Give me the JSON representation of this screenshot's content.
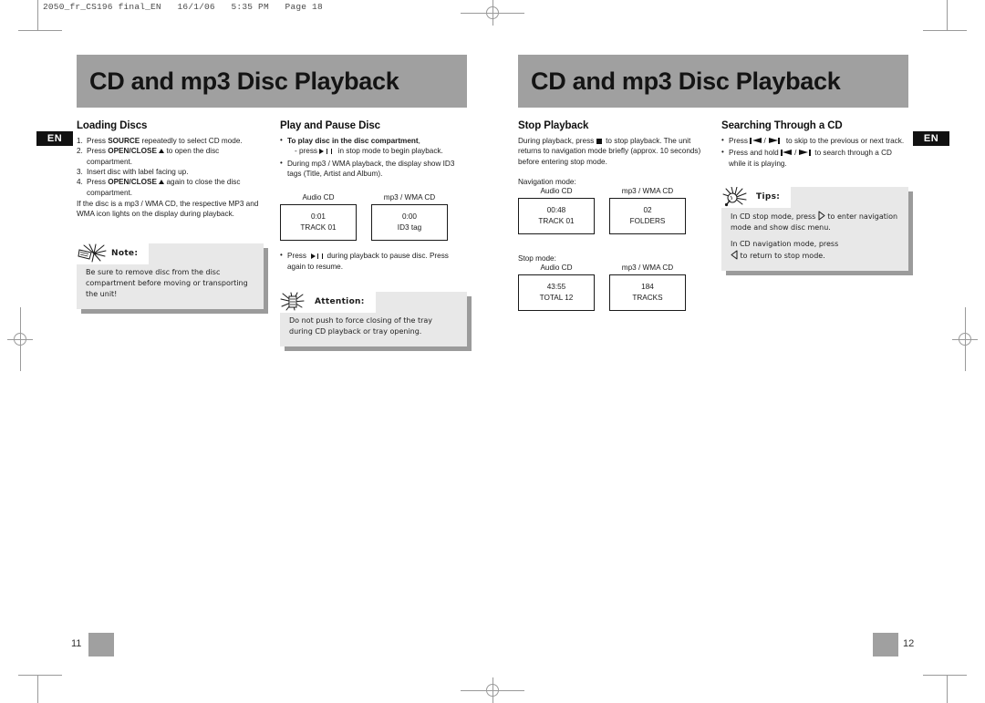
{
  "slug": "2050_fr_CS196 final_EN   16/1/06   5:35 PM   Page 18",
  "banner": {
    "left_title": "CD and mp3 Disc Playback",
    "right_title": "CD and mp3 Disc Playback"
  },
  "badges": {
    "en_left": "EN",
    "en_right": "EN"
  },
  "page_numbers": {
    "left": "11",
    "right": "12"
  },
  "colors": {
    "banner_gray": "#a0a0a0",
    "callout_gray": "#e8e8e8",
    "shadow_gray": "#9b9b9b",
    "badge_black": "#111111"
  },
  "left_page": {
    "col1": {
      "heading": "Loading Discs",
      "steps": [
        {
          "n": "1.",
          "pre": "Press ",
          "bold": "SOURCE",
          "post": " repeatedly to select CD mode."
        },
        {
          "n": "2.",
          "pre": "Press ",
          "bold": "OPEN/CLOSE",
          "post": " to open the disc compartment.",
          "icon": "eject-icon"
        },
        {
          "n": "3.",
          "pre": "Insert disc with label facing up.",
          "bold": "",
          "post": ""
        },
        {
          "n": "4.",
          "pre": "Press ",
          "bold": "OPEN/CLOSE",
          "post": " again to close the disc compartment.",
          "icon": "eject-icon"
        }
      ],
      "paragraph": "If the disc is a mp3 / WMA CD, the respective MP3 and WMA icon lights on the display during playback.",
      "note": {
        "label": "Note:",
        "icon": "note-starburst-icon",
        "text": "Be sure to remove disc from the disc compartment before moving or transporting the unit!"
      }
    },
    "col2": {
      "heading": "Play and Pause Disc",
      "bullets": [
        {
          "bold": "To play disc in the disc compartment",
          "after": ",",
          "sub_pre": "- press ",
          "sub_post": " in stop mode to begin playback.",
          "icon": "play-pause-icon"
        },
        {
          "plain": "During mp3 / WMA playback, the display show ID3 tags (Title, Artist and Album)."
        }
      ],
      "displays": [
        {
          "caption": "Audio CD",
          "line1": "0:01",
          "line2": "TRACK 01"
        },
        {
          "caption": "mp3 / WMA CD",
          "line1": "0:00",
          "line2": "ID3 tag"
        }
      ],
      "bullet_after": {
        "pre": "Press ",
        "post": " during playback to pause disc. Press again to resume.",
        "icon": "play-pause-icon"
      },
      "attention": {
        "label": "Attention:",
        "icon": "attention-starburst-icon",
        "text": "Do not push to force closing of the tray during CD playback or tray opening."
      }
    }
  },
  "right_page": {
    "col1": {
      "heading": "Stop Playback",
      "paragraph_pre": "During playback, press ",
      "paragraph_post": " to stop playback. The unit returns to navigation mode briefly (approx. 10 seconds) before entering stop mode.",
      "stop_icon": "stop-icon",
      "groups": [
        {
          "mode_label": "Navigation mode:",
          "displays": [
            {
              "caption": "Audio CD",
              "line1": "00:48",
              "line2": "TRACK 01"
            },
            {
              "caption": "mp3 / WMA CD",
              "line1": "02",
              "line2": "FOLDERS"
            }
          ]
        },
        {
          "mode_label": "Stop mode:",
          "displays": [
            {
              "caption": "Audio CD",
              "line1": "43:55",
              "line2": "TOTAL 12"
            },
            {
              "caption": "mp3 / WMA CD",
              "line1": "184",
              "line2": "TRACKS"
            }
          ]
        }
      ]
    },
    "col2": {
      "heading": "Searching Through a CD",
      "bullets": [
        {
          "pre": "Press ",
          "mid": " / ",
          "post": " to skip to the previous or next track."
        },
        {
          "pre": "Press and hold ",
          "mid": " / ",
          "post": " to search through a CD while it is playing."
        }
      ],
      "skip_icons": {
        "prev": "skip-previous-icon",
        "next": "skip-next-icon"
      },
      "tips": {
        "label": "Tips:",
        "icon": "lightbulb-icon",
        "line1_pre": "In CD stop mode, press ",
        "line1_post": " to enter navigation mode and show disc menu.",
        "line2_pre": "In CD navigation mode, press",
        "line2_post": " to return to stop mode.",
        "right_arrow_icon": "triangle-right-outline-icon",
        "left_arrow_icon": "triangle-left-outline-icon"
      }
    }
  }
}
